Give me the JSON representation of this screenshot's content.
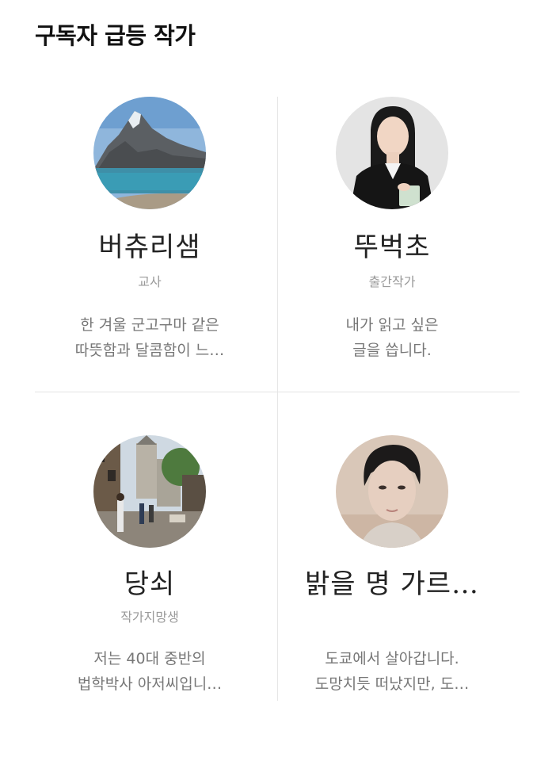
{
  "section": {
    "title": "구독자 급등 작가"
  },
  "authors": [
    {
      "name": "버츄리샘",
      "role": "교사",
      "desc_lines": [
        "한 겨울 군고구마 같은",
        "따뜻함과 달콤함이 느…"
      ],
      "avatar_icon": "mountain-lake-photo"
    },
    {
      "name": "뚜벅초",
      "role": "출간작가",
      "desc_lines": [
        "내가 읽고 싶은",
        "글을 씁니다."
      ],
      "avatar_icon": "woman-portrait-photo"
    },
    {
      "name": "당쇠",
      "role": "작가지망생",
      "desc_lines": [
        "저는 40대 중반의",
        "법학박사 아저씨입니…"
      ],
      "avatar_icon": "european-street-photo"
    },
    {
      "name": "밝을 명 가르…",
      "role": "",
      "desc_lines": [
        "도쿄에서 살아갑니다.",
        "도망치듯 떠났지만, 도…"
      ],
      "avatar_icon": "man-portrait-photo"
    }
  ]
}
